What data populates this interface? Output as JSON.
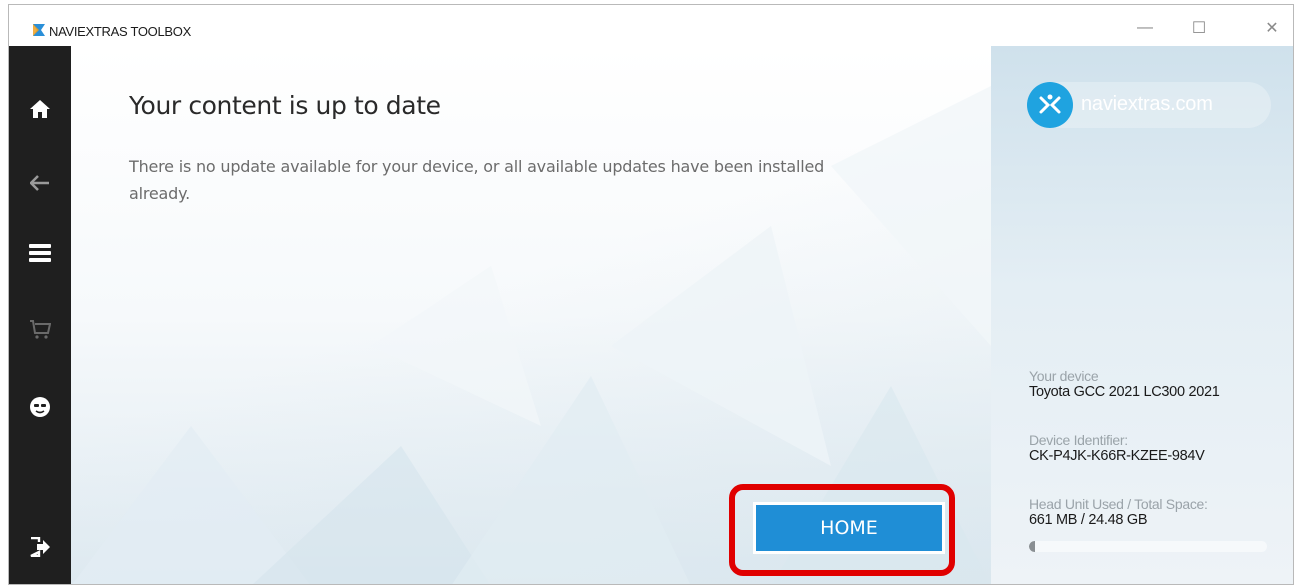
{
  "window": {
    "title": "NAVIEXTRAS TOOLBOX",
    "controls": {
      "minimize": "—",
      "maximize": "☐",
      "close": "✕"
    }
  },
  "sidebar": {
    "items": [
      {
        "name": "home",
        "icon": "home-icon"
      },
      {
        "name": "back",
        "icon": "arrow-left-icon"
      },
      {
        "name": "menu",
        "icon": "menu-icon"
      },
      {
        "name": "cart",
        "icon": "cart-icon"
      },
      {
        "name": "profile",
        "icon": "profile-icon"
      },
      {
        "name": "exit",
        "icon": "exit-icon"
      }
    ]
  },
  "main": {
    "headline": "Your content is up to date",
    "message": "There is no update available for your device, or all available updates have been installed already.",
    "home_button_label": "HOME"
  },
  "panel": {
    "logo_text": "naviextras.com",
    "device_label": "Your device",
    "device_name": "Toyota GCC 2021 LC300 2021",
    "identifier_label": "Device Identifier:",
    "identifier_value": "CK-P4JK-K66R-KZEE-984V",
    "space_label": "Head Unit Used / Total Space:",
    "space_value": "661 MB / 24.48 GB",
    "storage_used_fraction": 0.026
  },
  "colors": {
    "accent": "#1f8ed6",
    "sidebar": "#1f1f1f",
    "highlight": "#e00000"
  }
}
